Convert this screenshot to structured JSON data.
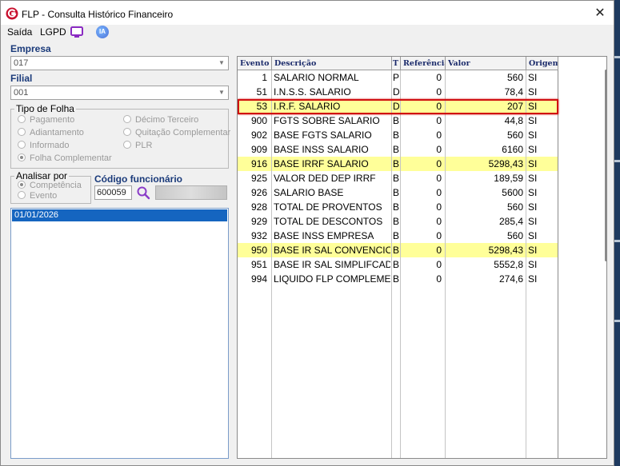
{
  "window": {
    "title": "FLP - Consulta Histórico Financeiro",
    "close_symbol": "✕"
  },
  "menu": {
    "saida": "Saída",
    "lgpd": "LGPD",
    "ia": "IA"
  },
  "empresa": {
    "label": "Empresa",
    "value": "017"
  },
  "filial": {
    "label": "Filial",
    "value": "001"
  },
  "tipo_folha": {
    "legend": "Tipo de Folha",
    "options": [
      {
        "label": "Pagamento",
        "selected": false
      },
      {
        "label": "Adiantamento",
        "selected": false
      },
      {
        "label": "Informado",
        "selected": false
      },
      {
        "label": "Folha Complementar",
        "selected": true
      },
      {
        "label": "Décimo Terceiro",
        "selected": false
      },
      {
        "label": "Quitação Complementar",
        "selected": false
      },
      {
        "label": "PLR",
        "selected": false
      }
    ]
  },
  "analisar_por": {
    "legend": "Analisar por",
    "options": [
      {
        "label": "Competência",
        "selected": true
      },
      {
        "label": "Evento",
        "selected": false
      }
    ]
  },
  "funcionario": {
    "label": "Código funcionário",
    "code": "600059"
  },
  "periods": [
    "01/01/2026"
  ],
  "grid": {
    "columns": [
      "Evento",
      "Descrição",
      "T",
      "Referência",
      "Valor",
      "Origem"
    ],
    "rows": [
      {
        "evento": "1",
        "descricao": "SALARIO NORMAL",
        "t": "P",
        "referencia": "0",
        "valor": "560",
        "origem": "SI",
        "highlight": false
      },
      {
        "evento": "51",
        "descricao": "I.N.S.S. SALARIO",
        "t": "D",
        "referencia": "0",
        "valor": "78,4",
        "origem": "SI",
        "highlight": false
      },
      {
        "evento": "53",
        "descricao": "I.R.F. SALARIO",
        "t": "D",
        "referencia": "0",
        "valor": "207",
        "origem": "SI",
        "highlight": true
      },
      {
        "evento": "900",
        "descricao": "FGTS SOBRE SALARIO",
        "t": "B",
        "referencia": "0",
        "valor": "44,8",
        "origem": "SI",
        "highlight": false
      },
      {
        "evento": "902",
        "descricao": "BASE FGTS SALARIO",
        "t": "B",
        "referencia": "0",
        "valor": "560",
        "origem": "SI",
        "highlight": false
      },
      {
        "evento": "909",
        "descricao": "BASE INSS SALARIO",
        "t": "B",
        "referencia": "0",
        "valor": "6160",
        "origem": "SI",
        "highlight": false
      },
      {
        "evento": "916",
        "descricao": "BASE IRRF SALARIO",
        "t": "B",
        "referencia": "0",
        "valor": "5298,43",
        "origem": "SI",
        "highlight": true
      },
      {
        "evento": "925",
        "descricao": "VALOR DED DEP IRRF",
        "t": "B",
        "referencia": "0",
        "valor": "189,59",
        "origem": "SI",
        "highlight": false
      },
      {
        "evento": "926",
        "descricao": "SALARIO BASE",
        "t": "B",
        "referencia": "0",
        "valor": "5600",
        "origem": "SI",
        "highlight": false
      },
      {
        "evento": "928",
        "descricao": "TOTAL DE PROVENTOS",
        "t": "B",
        "referencia": "0",
        "valor": "560",
        "origem": "SI",
        "highlight": false
      },
      {
        "evento": "929",
        "descricao": "TOTAL DE DESCONTOS",
        "t": "B",
        "referencia": "0",
        "valor": "285,4",
        "origem": "SI",
        "highlight": false
      },
      {
        "evento": "932",
        "descricao": "BASE INSS EMPRESA",
        "t": "B",
        "referencia": "0",
        "valor": "560",
        "origem": "SI",
        "highlight": false
      },
      {
        "evento": "950",
        "descricao": "BASE IR SAL CONVENCION",
        "t": "B",
        "referencia": "0",
        "valor": "5298,43",
        "origem": "SI",
        "highlight": true
      },
      {
        "evento": "951",
        "descricao": "BASE IR SAL SIMPLIFCAD",
        "t": "B",
        "referencia": "0",
        "valor": "5552,8",
        "origem": "SI",
        "highlight": false
      },
      {
        "evento": "994",
        "descricao": "LIQUIDO FLP COMPLEMENT",
        "t": "B",
        "referencia": "0",
        "valor": "274,6",
        "origem": "SI",
        "highlight": false
      }
    ]
  },
  "colors": {
    "highlight_row": "#ffff99",
    "selection_border": "#d01010",
    "selected_period": "#1565c0",
    "label_blue": "#1a3a7a"
  },
  "icons": [
    "app-logo-icon",
    "close-icon",
    "monitor-icon",
    "ia-icon",
    "search-icon",
    "chevron-down-icon"
  ]
}
